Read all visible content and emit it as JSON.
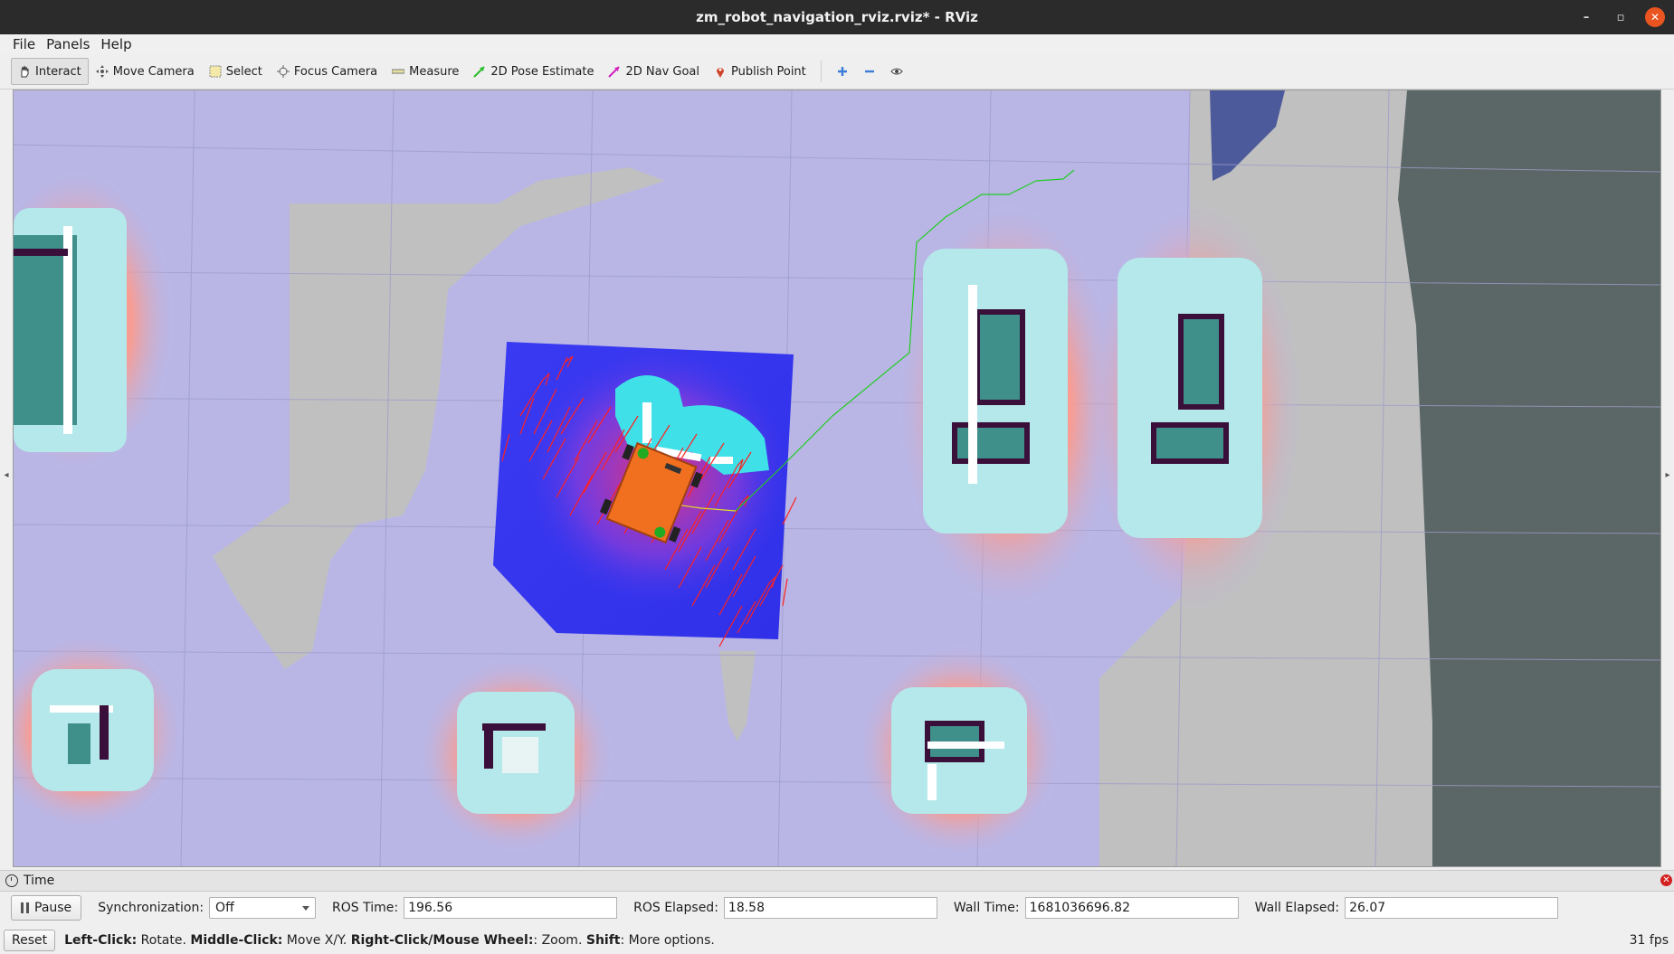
{
  "window": {
    "title": "zm_robot_navigation_rviz.rviz* - RViz",
    "minimize": "–",
    "restore": "▫",
    "close": "✕"
  },
  "menu": [
    "File",
    "Panels",
    "Help"
  ],
  "toolbar": {
    "tools": [
      {
        "label": "Interact",
        "icon": "interact-hand-icon",
        "active": true
      },
      {
        "label": "Move Camera",
        "icon": "move-camera-icon"
      },
      {
        "label": "Select",
        "icon": "select-box-icon"
      },
      {
        "label": "Focus Camera",
        "icon": "focus-target-icon"
      },
      {
        "label": "Measure",
        "icon": "ruler-icon"
      },
      {
        "label": "2D Pose Estimate",
        "icon": "green-arrow-icon"
      },
      {
        "label": "2D Nav Goal",
        "icon": "magenta-arrow-icon"
      },
      {
        "label": "Publish Point",
        "icon": "map-pin-icon"
      }
    ],
    "extra_icons": [
      "add-tool-icon",
      "remove-tool-icon",
      "eye-icon"
    ]
  },
  "colors": {
    "map_free": "#b9b6e6",
    "unknown": "#c0c0c0",
    "outside": "#5b6666",
    "inflation": "#b4e8ea",
    "local_costmap": "#3c3cf0",
    "particles": "#ff2020",
    "robot": "#f07020",
    "path": "#22cc22"
  },
  "time_panel": {
    "title": "Time",
    "pause_label": "Pause",
    "sync_label": "Synchronization:",
    "sync_value": "Off",
    "ros_time_label": "ROS Time:",
    "ros_time": "196.56",
    "ros_elapsed_label": "ROS Elapsed:",
    "ros_elapsed": "18.58",
    "wall_time_label": "Wall Time:",
    "wall_time": "1681036696.82",
    "wall_elapsed_label": "Wall Elapsed:",
    "wall_elapsed": "26.07"
  },
  "status": {
    "reset_label": "Reset",
    "hint_left_bold": "Left-Click:",
    "hint_left": " Rotate. ",
    "hint_middle_bold": "Middle-Click:",
    "hint_middle": " Move X/Y. ",
    "hint_right_bold": "Right-Click/Mouse Wheel:",
    "hint_right": ": Zoom. ",
    "hint_shift_bold": "Shift",
    "hint_shift": ": More options.",
    "fps": "31 fps"
  }
}
